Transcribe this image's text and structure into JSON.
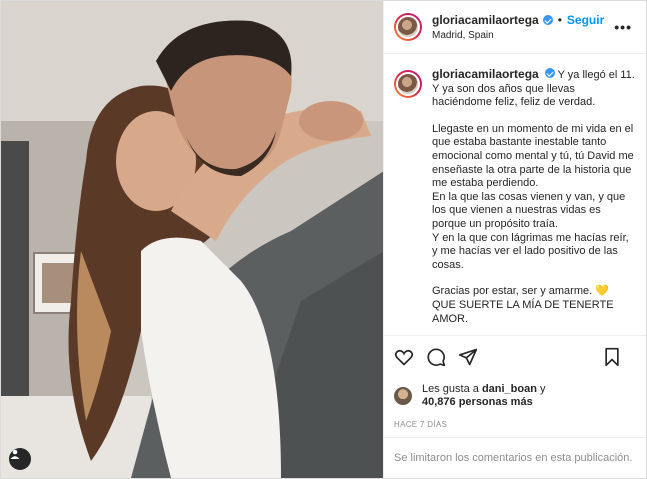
{
  "header": {
    "username": "gloriacamilaortega",
    "separator": "•",
    "follow_label": "Seguir",
    "location": "Madrid, Spain",
    "more_label": "•••"
  },
  "caption": {
    "username": "gloriacamilaortega",
    "lines": [
      "Y ya llegó el 11.",
      "Y ya son dos años que llevas haciéndome feliz, feliz de verdad.",
      "Llegaste en un momento de mi vida en el que estaba bastante inestable tanto emocional como mental y tú, tú David me enseñaste la otra parte de la historia que me estaba perdiendo.",
      "En la que las cosas vienen y van, y que los que vienen a nuestras vidas es porque un propósito traía.",
      "Y en la que con lágrimas me hacías reír, y me hacías ver el lado positivo de las cosas.",
      "Gracias por estar, ser y amarme.",
      "QUE SUERTE LA MÍA DE TENERTE AMOR."
    ],
    "emoji": "💛"
  },
  "likes": {
    "prefix": "Les gusta a",
    "user": "dani_boan",
    "connector": "y",
    "count": "40,876 personas más"
  },
  "time_ago": "HACE 7 DÍAS",
  "comments_disabled": "Se limitaron los comentarios en esta publicación.",
  "icons": [
    "heart-icon",
    "comment-icon",
    "share-icon",
    "bookmark-icon",
    "verified-icon",
    "user-tag-icon"
  ],
  "colors": {
    "accent": "#0095f6",
    "verified": "#3897f0",
    "muted": "#8e8e8e"
  }
}
